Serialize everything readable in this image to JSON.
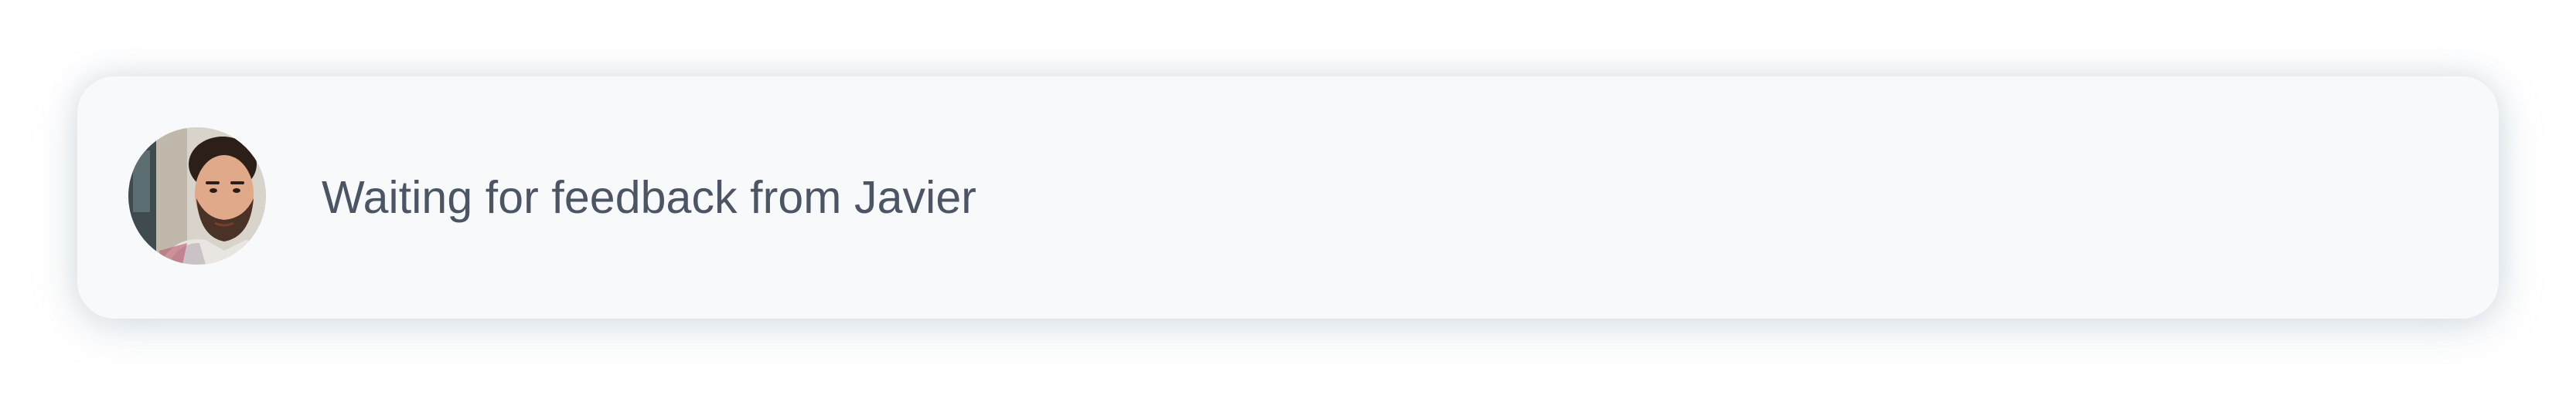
{
  "notification": {
    "message": "Waiting for feedback from Javier",
    "avatar_icon": "user-avatar-photo",
    "colors": {
      "card_background": "#f7f9fb",
      "text": "#4b5563"
    }
  }
}
